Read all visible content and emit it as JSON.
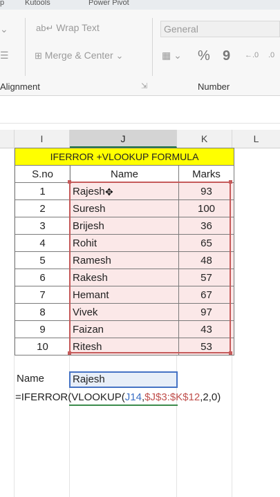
{
  "ribbon": {
    "top_items": [
      "p",
      "Kutools",
      "Power Pivot"
    ],
    "wrap_text": "Wrap Text",
    "merge_center": "Merge & Center",
    "number_format": "General",
    "percent": "%",
    "comma": "9",
    "alignment_label": "Alignment",
    "number_label": "Number"
  },
  "columns": [
    "I",
    "J",
    "K",
    "L"
  ],
  "table": {
    "title": "IFERROR +VLOOKUP FORMULA",
    "headers": [
      "S.no",
      "Name",
      "Marks"
    ],
    "rows": [
      [
        "1",
        "Rajesh",
        "93"
      ],
      [
        "2",
        "Suresh",
        "100"
      ],
      [
        "3",
        "Brijesh",
        "36"
      ],
      [
        "4",
        "Rohit",
        "65"
      ],
      [
        "5",
        "Ramesh",
        "48"
      ],
      [
        "6",
        "Rakesh",
        "57"
      ],
      [
        "7",
        "Hemant",
        "67"
      ],
      [
        "8",
        "Vivek",
        "97"
      ],
      [
        "9",
        "Faizan",
        "43"
      ],
      [
        "10",
        "Ritesh",
        "53"
      ]
    ]
  },
  "lookup": {
    "label": "Name",
    "value": "Rajesh",
    "formula_prefix": "=IFERROR(VLOOKUP(",
    "formula_ref1": "J14",
    "formula_comma1": ",",
    "formula_ref2": "$J$3:$K$12",
    "formula_suffix": ",2,0)"
  },
  "colors": {
    "title_fill": "#ffff00",
    "range_border": "#c55a5a",
    "range_fill": "#fbe8e8",
    "active_cell_border": "#4472c4"
  }
}
